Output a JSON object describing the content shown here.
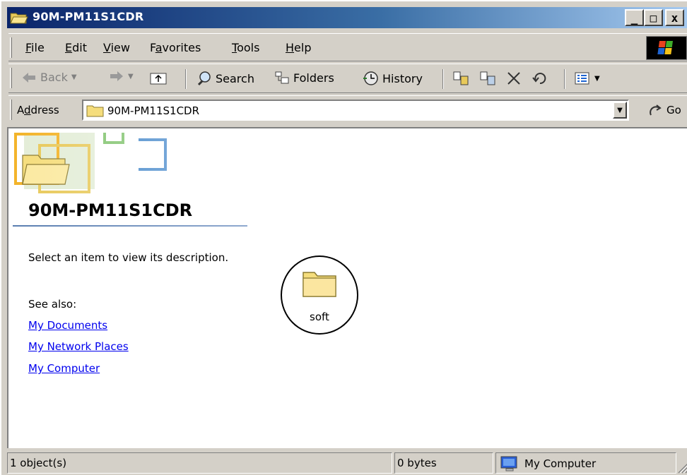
{
  "window": {
    "title": "90M-PM11S1CDR",
    "minimize_glyph": "_",
    "maximize_glyph": "□",
    "close_glyph": "x"
  },
  "menu": [
    {
      "label": "File",
      "accel": "F",
      "rest": "ile"
    },
    {
      "label": "Edit",
      "accel": "E",
      "rest": "dit"
    },
    {
      "label": "View",
      "accel": "V",
      "rest": "iew"
    },
    {
      "label": "Favorites",
      "pre": "F",
      "accel": "a",
      "rest": "vorites"
    },
    {
      "label": "Tools",
      "accel": "T",
      "rest": "ools"
    },
    {
      "label": "Help",
      "accel": "H",
      "rest": "elp"
    }
  ],
  "toolbar": {
    "back": "Back",
    "search": "Search",
    "folders": "Folders",
    "history": "History"
  },
  "address": {
    "label_pre": "A",
    "label_accel": "d",
    "label_rest": "dress",
    "value": "90M-PM11S1CDR",
    "go": "Go"
  },
  "sidepanel": {
    "folder_title": "90M-PM11S1CDR",
    "description": "Select an item to view its description.",
    "see_also": "See also:",
    "links": [
      "My Documents",
      "My Network Places",
      "My Computer"
    ]
  },
  "files": [
    {
      "name": "soft",
      "icon": "folder-icon",
      "highlighted": true
    }
  ],
  "status": {
    "objects": "1 object(s)",
    "size": "0 bytes",
    "zone": "My Computer"
  },
  "colors": {
    "title_gradient_start": "#0a246a",
    "title_gradient_end": "#a6caf0",
    "chrome": "#d4d0c8",
    "link": "#0000ee",
    "folder": "#f5dd7c"
  }
}
